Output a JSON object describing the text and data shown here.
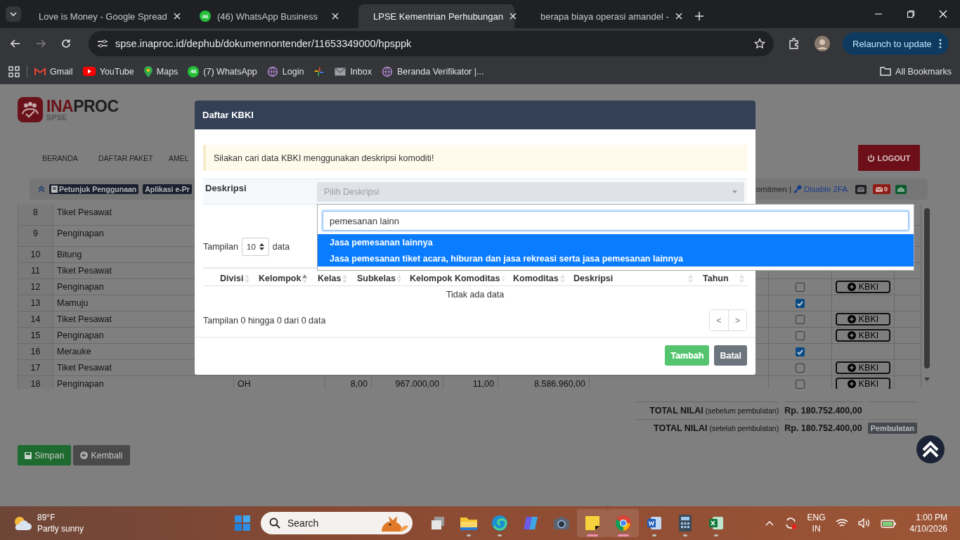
{
  "browser": {
    "tabs": [
      {
        "title": "Love is Money - Google Spread",
        "kind": "sheets",
        "selected": false
      },
      {
        "title": "(46) WhatsApp Business",
        "kind": "whatsapp",
        "badge": "46",
        "selected": false
      },
      {
        "title": "LPSE Kementrian Perhubungan",
        "kind": "lpse",
        "selected": true
      },
      {
        "title": "berapa biaya operasi amandel -",
        "kind": "google",
        "selected": false
      }
    ],
    "url": "spse.inaproc.id/dephub/dokumennontender/11653349000/hpsppk",
    "relaunch": "Relaunch to update",
    "bookmarks": [
      {
        "label": "Gmail",
        "kind": "gmail"
      },
      {
        "label": "YouTube",
        "kind": "youtube"
      },
      {
        "label": "Maps",
        "kind": "maps"
      },
      {
        "label": "(7) WhatsApp",
        "kind": "whatsapp",
        "badge": "46"
      },
      {
        "label": "Login",
        "kind": "globe"
      },
      {
        "kind": "photos"
      },
      {
        "label": "Inbox",
        "kind": "mail"
      },
      {
        "label": "Beranda Verifikator |...",
        "kind": "globe"
      }
    ],
    "all_bookmarks": "All Bookmarks"
  },
  "page": {
    "logo": {
      "accent": "INA",
      "rest": "PROC",
      "sub": "SPSE"
    },
    "nav": [
      "BERANDA",
      "DAFTAR PAKET",
      "AMEL"
    ],
    "logout": "LOGOUT",
    "strip": {
      "badges": [
        "Petunjuk Penggunaan",
        "Aplikasi e-Pr"
      ],
      "text": "omitmen |",
      "link": "Disable 2FA",
      "inbox_count": "0"
    },
    "rows": [
      {
        "no": "8",
        "name": "Tiket Pesawat"
      },
      {
        "no": "9",
        "name": "Penginapan"
      },
      {
        "no": "10",
        "name": "Bitung"
      },
      {
        "no": "11",
        "name": "Tiket Pesawat"
      },
      {
        "no": "12",
        "name": "Penginapan",
        "checked": false,
        "button": "KBKI"
      },
      {
        "no": "13",
        "name": "Mamuju",
        "checked": true
      },
      {
        "no": "14",
        "name": "Tiket Pesawat",
        "checked": false,
        "button": "KBKI"
      },
      {
        "no": "15",
        "name": "Penginapan",
        "checked": false,
        "button": "KBKI"
      },
      {
        "no": "16",
        "name": "Merauke",
        "checked": true
      },
      {
        "no": "17",
        "name": "Tiket Pesawat",
        "checked": false,
        "button": "KBKI"
      },
      {
        "no": "18",
        "name": "Penginapan",
        "cells": [
          "OH",
          "8,00",
          "967.000,00",
          "11,00",
          "8.586.960,00"
        ],
        "checked": false,
        "button": "KBKI"
      }
    ],
    "totals": [
      {
        "label": "TOTAL NILAI",
        "note": "(sebelum pembulatan)",
        "value": "Rp. 180.752.400,00"
      },
      {
        "label": "TOTAL NILAI",
        "note": "(setelah pembulatan)",
        "value": "Rp. 180.752.400,00",
        "badge": "Pembulatan"
      }
    ],
    "buttons": [
      {
        "label": "Simpan",
        "kind": "save"
      },
      {
        "label": "Kembali",
        "kind": "back"
      }
    ]
  },
  "modal": {
    "title": "Daftar KBKI",
    "alert": "Silakan cari data KBKI menggunakan deskripsi komoditi!",
    "field_label": "Deskripsi",
    "select_placeholder": "Pilih Deskripsi",
    "length_prefix": "Tampilan",
    "length_value": "10",
    "length_suffix": "data",
    "columns": [
      {
        "label": "Divisi",
        "sorted": false
      },
      {
        "label": "Kelompok",
        "sorted": true
      },
      {
        "label": "Kelas",
        "sorted": false
      },
      {
        "label": "Subkelas",
        "sorted": false
      },
      {
        "label": "Kelompok Komoditas",
        "sorted": false
      },
      {
        "label": "Komoditas",
        "sorted": false
      },
      {
        "label": "Deskripsi",
        "sorted": false
      },
      {
        "label": "Tahun",
        "sorted": false
      }
    ],
    "empty_text": "Tidak ada data",
    "info": "Tampilan 0 hingga 0 dari 0 data",
    "pager": [
      "<",
      ">"
    ],
    "buttons": [
      {
        "label": "Tambah",
        "kind": "success",
        "disabled": true
      },
      {
        "label": "Batal",
        "kind": "secondary",
        "disabled": false
      }
    ]
  },
  "dropdown": {
    "search_value": "pemesanan lainn",
    "options": [
      {
        "label": "Jasa pemesanan lainnya",
        "highlighted": true
      },
      {
        "label": "Jasa pemesanan tiket acara, hiburan dan jasa rekreasi serta jasa pemesanan lainnya",
        "highlighted": true
      }
    ]
  },
  "taskbar": {
    "weather": {
      "temp": "89°F",
      "text": "Partly sunny"
    },
    "search": "Search",
    "apps": [
      {
        "kind": "taskview",
        "running": false,
        "focused": false
      },
      {
        "kind": "explorer",
        "running": true,
        "focused": false
      },
      {
        "kind": "edge",
        "running": true,
        "focused": false
      },
      {
        "kind": "copilot",
        "running": false,
        "focused": false
      },
      {
        "kind": "camera",
        "running": false,
        "focused": false
      },
      {
        "kind": "sticky",
        "running": true,
        "focused": true
      },
      {
        "kind": "chrome",
        "running": true,
        "focused": true
      },
      {
        "kind": "word",
        "running": true,
        "focused": false
      },
      {
        "kind": "calculator",
        "running": true,
        "focused": false
      },
      {
        "kind": "excel",
        "running": true,
        "focused": false
      }
    ],
    "lang": "ENG",
    "region": "IN",
    "time": "1:00 PM",
    "date": "4/10/2026"
  }
}
